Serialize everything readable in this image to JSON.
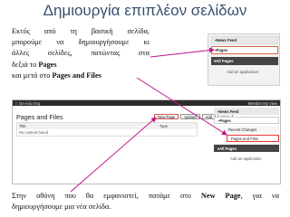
{
  "slide": {
    "title": "Δημιουργία επιπλέον σελίδων",
    "intro": {
      "line1": "Εκτός από τη βασική σελίδα,",
      "line2": "μπορούμε να δημιουργήσουμε κι",
      "line3": "άλλες σελίδες, πατώντας στα",
      "line4a": "δεξιά το ",
      "line4b": "Pages",
      "line5a": "και μετά στο ",
      "line5b": "Pages and Files"
    },
    "outro": {
      "line1a": "Στην οθόνη που θα εμφανιστεί, πατάμε στο ",
      "line1b": "New Page",
      "line1c": ", για να",
      "line2": "δημιουργήσουμε μια νέα σελίδα."
    }
  },
  "small_screenshot": {
    "news_feed": "News Feed",
    "pages": "Pages",
    "all_pages": "All Pages",
    "add_app": "Add an application"
  },
  "big_screenshot": {
    "topbar_left": "ℂ l3e-edu.ning",
    "topbar_right": "Member   My View",
    "page_title": "Pages and Files",
    "toolbar": {
      "new_page": "New Page",
      "upload": "Upload",
      "add": "Add",
      "view": "View"
    },
    "table": {
      "col_title": "Title",
      "col_type": "Type",
      "empty_text": "No content found"
    },
    "sidebar": {
      "news_feed": "News Feed",
      "pages": "Pages",
      "recent_changes": "Recent Changes",
      "pages_and_files": "Pages and Files",
      "all_pages": "All Pages",
      "add_app": "Add an application"
    }
  },
  "colors": {
    "title": "#3a4f6e",
    "arrow": "#c0168a",
    "highlight": "#dd3333"
  }
}
